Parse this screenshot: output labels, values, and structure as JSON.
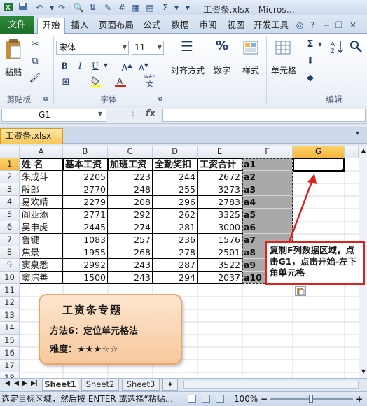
{
  "titlebar": {
    "title": "工资条.xlsx - Micros..."
  },
  "ribbon": {
    "file_tab": "文件",
    "tabs": [
      "开始",
      "插入",
      "页面布局",
      "公式",
      "数据",
      "审阅",
      "视图",
      "开发工具"
    ],
    "active_tab": "开始",
    "clipboard": {
      "paste": "粘贴",
      "group": "剪贴板"
    },
    "font": {
      "name": "宋体",
      "size": "11",
      "group": "字体",
      "wen_label": "wén"
    },
    "alignment": {
      "label": "对齐方式"
    },
    "number": {
      "label": "数字",
      "symbol": "%"
    },
    "styles": {
      "label": "样式"
    },
    "cells": {
      "label": "单元格"
    },
    "editing": {
      "group": "编辑"
    }
  },
  "formula_bar": {
    "name_box": "G1",
    "fx": "fx",
    "formula": ""
  },
  "workbook": {
    "tab": "工资条.xlsx"
  },
  "grid": {
    "columns": [
      "A",
      "B",
      "C",
      "D",
      "E",
      "F",
      "G"
    ],
    "selected_column": "G",
    "header_row": [
      "姓 名",
      "基本工资",
      "加班工资",
      "全勤奖扣",
      "工资合计",
      "a1"
    ],
    "rows": [
      [
        "朱成斗",
        "2205",
        "223",
        "244",
        "2672",
        "a2"
      ],
      [
        "殷郎",
        "2770",
        "248",
        "255",
        "3273",
        "a3"
      ],
      [
        "易欢靖",
        "2279",
        "208",
        "296",
        "2783",
        "a4"
      ],
      [
        "阎亚添",
        "2771",
        "292",
        "262",
        "3325",
        "a5"
      ],
      [
        "吴申虎",
        "2445",
        "274",
        "281",
        "3000",
        "a6"
      ],
      [
        "鲁键",
        "1083",
        "257",
        "236",
        "1576",
        "a7"
      ],
      [
        "焦景",
        "1955",
        "268",
        "278",
        "2501",
        "a8"
      ],
      [
        "窦泉悉",
        "2992",
        "243",
        "287",
        "3522",
        "a9"
      ],
      [
        "窦淙善",
        "1500",
        "243",
        "294",
        "2037",
        "a10"
      ]
    ],
    "row_numbers": [
      "1",
      "2",
      "3",
      "4",
      "5",
      "6",
      "7",
      "8",
      "9",
      "10",
      "11",
      "12",
      "13",
      "14",
      "15",
      "16",
      "17",
      "18",
      "19"
    ]
  },
  "tip_card": {
    "title": "工资条专题",
    "method": "方法6：定位单元格法",
    "difficulty_label": "难度：",
    "stars": "★★★☆☆"
  },
  "callout": {
    "text": "复制F列数据区域，点击G1，点击开始-左下角单元格"
  },
  "sheets": {
    "tabs": [
      "Sheet1",
      "Sheet2",
      "Sheet3"
    ],
    "active": "Sheet1"
  },
  "status": {
    "message": "选定目标区域，然后按 ENTER 或选择“粘贴...",
    "zoom": "100%"
  },
  "colors": {
    "accent_red": "#e0201c",
    "selection_gold": "#f5b53f",
    "file_tab_green": "#1d6f2a",
    "f_column_gray": "#a9a9a9"
  }
}
